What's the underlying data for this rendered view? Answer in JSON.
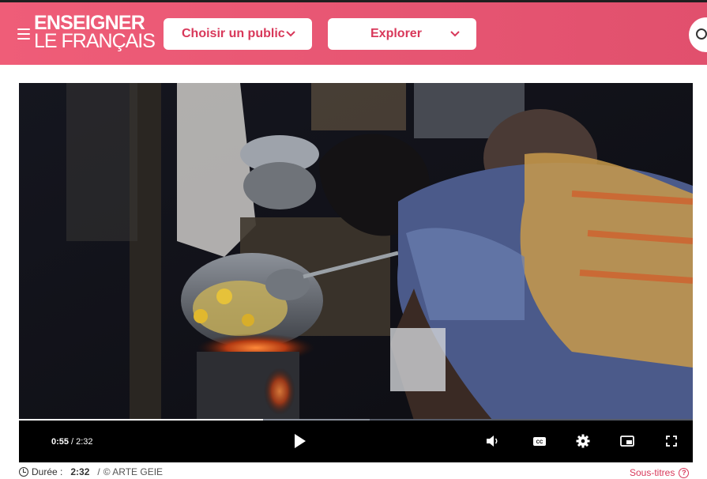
{
  "site": {
    "logo_line1": "ENSEIGNER",
    "logo_line2": "LE FRANÇAIS",
    "brand_color": "#e65572"
  },
  "nav": {
    "menu_icon": "hamburger-icon",
    "buttons": [
      {
        "label": "Choisir un public",
        "icon": "chevron-down-icon"
      },
      {
        "label": "Explorer",
        "icon": "chevron-down-icon"
      }
    ],
    "search_icon": "search-icon"
  },
  "player": {
    "current_time": "0:55",
    "separator": "/",
    "duration": "2:32",
    "progress_fraction": 0.3618,
    "buffered_fraction": 0.52,
    "controls": [
      "play-icon",
      "volume-icon",
      "closed-captions-icon",
      "settings-gear-icon",
      "picture-in-picture-icon",
      "fullscreen-icon"
    ]
  },
  "meta": {
    "duration_label": "Durée :",
    "duration_value": "2:32",
    "slash": "/",
    "credit": "© ARTE GEIE",
    "subtitles_label": "Sous-titres",
    "help_glyph": "?"
  }
}
